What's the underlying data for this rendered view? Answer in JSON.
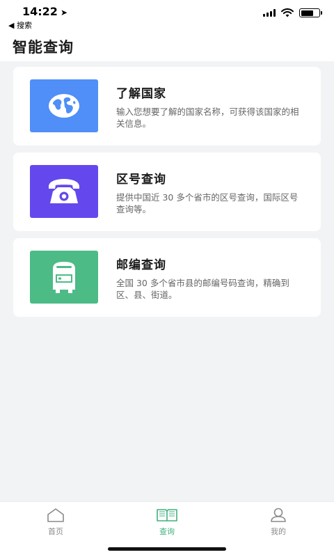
{
  "status_bar": {
    "time": "14:22",
    "back_label": "◀ 搜索",
    "battery_level": 0.7
  },
  "header": {
    "title": "智能查询"
  },
  "cards": [
    {
      "title": "了解国家",
      "description": "输入您想要了解的国家名称，可获得该国家的相关信息。",
      "icon": "globe-icon",
      "color": "#4f8ff7"
    },
    {
      "title": "区号查询",
      "description": "提供中国近 30 多个省市的区号查询，国际区号查询等。",
      "icon": "telephone-icon",
      "color": "#6448ee"
    },
    {
      "title": "邮编查询",
      "description": "全国 30 多个省市县的邮编号码查询，精确到区、县、街道。",
      "icon": "mailbox-icon",
      "color": "#4dbb86"
    }
  ],
  "tabs": [
    {
      "label": "首页",
      "icon": "home-icon",
      "active": false
    },
    {
      "label": "查询",
      "icon": "book-icon",
      "active": true
    },
    {
      "label": "我的",
      "icon": "user-icon",
      "active": false
    }
  ],
  "colors": {
    "accent": "#3fb17d",
    "inactive": "#8a8a8a"
  }
}
